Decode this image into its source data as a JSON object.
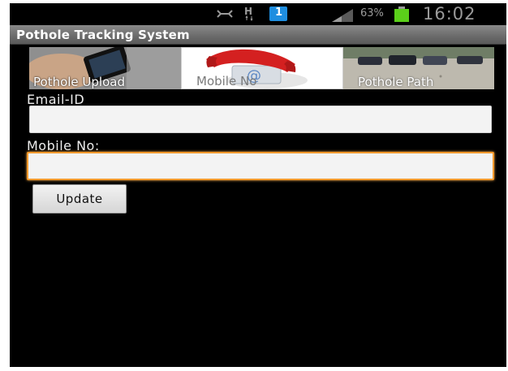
{
  "status_bar": {
    "battery_percent": "63%",
    "time": "16:02",
    "notification_badge": "1",
    "network_type": "H",
    "icons": [
      "usb-debug-icon",
      "network-h-icon",
      "notification-badge-icon",
      "signal-icon",
      "battery-icon"
    ],
    "battery_color": "#5bd01a"
  },
  "app": {
    "title": "Pothole Tracking System"
  },
  "tabs": [
    {
      "label": "Pothole Upload",
      "image": "phone-in-hand-photo"
    },
    {
      "label": "Mobile No",
      "image": "telephone-handset-image"
    },
    {
      "label": "Pothole Path",
      "image": "road-with-cars-photo"
    }
  ],
  "form": {
    "email_label": "Email-ID",
    "email_value": "",
    "mobile_label": "Mobile No:",
    "mobile_value": "",
    "update_label": "Update"
  },
  "colors": {
    "focus_accent": "#f29a2e",
    "background": "#000000",
    "field_background": "#f3f3f3"
  }
}
